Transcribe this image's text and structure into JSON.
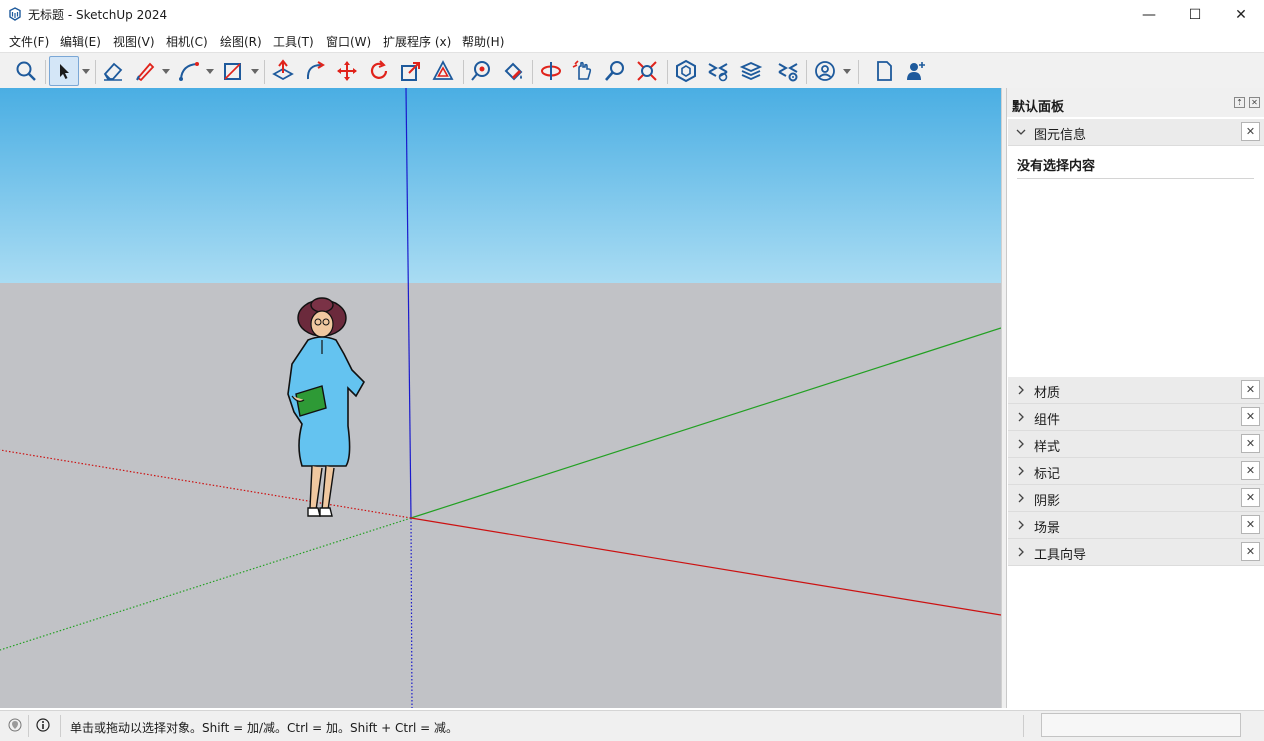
{
  "window": {
    "title": "无标题 - SketchUp 2024",
    "controls": {
      "minimize": "—",
      "maximize": "☐",
      "close": "✕"
    }
  },
  "menu": [
    {
      "label": "文件(F)"
    },
    {
      "label": "编辑(E)"
    },
    {
      "label": "视图(V)"
    },
    {
      "label": "相机(C)"
    },
    {
      "label": "绘图(R)"
    },
    {
      "label": "工具(T)"
    },
    {
      "label": "窗口(W)"
    },
    {
      "label": "扩展程序 (x)"
    },
    {
      "label": "帮助(H)"
    }
  ],
  "toolbar": {
    "tools": [
      "search-icon",
      "select-arrow-icon",
      "eraser-icon",
      "pencil-line-icon",
      "arc-icon",
      "rectangle-icon",
      "push-pull-icon",
      "follow-me-icon",
      "move-icon",
      "rotate-icon",
      "scale-icon",
      "offset-icon",
      "tape-measure-icon",
      "paint-bucket-icon",
      "orbit-icon",
      "pan-icon",
      "zoom-icon",
      "zoom-extents-icon",
      "3d-warehouse-icon",
      "extension-warehouse-icon",
      "layout-icon",
      "extension-manager-icon",
      "account-icon",
      "new-file-icon",
      "add-user-icon"
    ],
    "accent": "#1e5a9c",
    "red_accent": "#e0231b"
  },
  "viewport": {
    "sky_colors": [
      "#4aaee3",
      "#a9dcf3"
    ],
    "ground_color": "#c1c2c6",
    "axis_colors": {
      "red": "#cc1111",
      "green": "#22a022",
      "blue": "#1a1acc"
    }
  },
  "tray": {
    "title": "默认面板",
    "entity_info": {
      "label": "图元信息",
      "content": "没有选择内容"
    },
    "panels": [
      {
        "label": "材质"
      },
      {
        "label": "组件"
      },
      {
        "label": "样式"
      },
      {
        "label": "标记"
      },
      {
        "label": "阴影"
      },
      {
        "label": "场景"
      },
      {
        "label": "工具向导"
      }
    ],
    "close_glyph": "✕"
  },
  "status": {
    "text": "单击或拖动以选择对象。Shift = 加/减。Ctrl = 加。Shift + Ctrl = 减。"
  }
}
